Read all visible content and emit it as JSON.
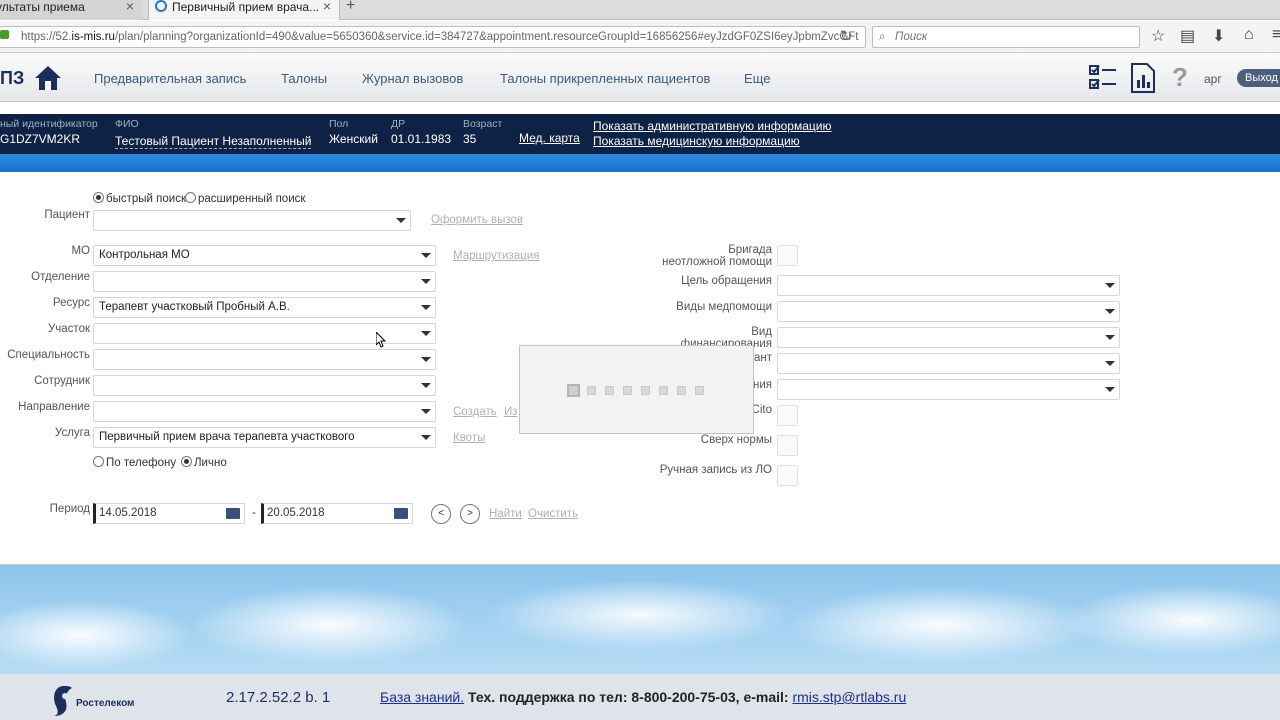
{
  "browser": {
    "tabs": [
      {
        "label": "ультаты приема"
      },
      {
        "label": "Первичный прием врача..."
      }
    ],
    "url_prefix": "https://52.",
    "url_domain": "is-mis.ru",
    "url_rest": "/plan/planning?organizationId=490&value=5650360&service.id=384727&appointment.resourceGroupId=16856256#eyJzdGF0ZSI6eyJpbmZvcGFt",
    "search_placeholder": "Поиск"
  },
  "app": {
    "logo": "ПЗ",
    "menu": [
      "Предварительная запись",
      "Талоны",
      "Журнал вызовов",
      "Талоны прикрепленных пациентов",
      "Еще"
    ],
    "username": "арг",
    "logout": "Выход"
  },
  "patient": {
    "id_label": "ный идентификатор",
    "id_value": "G1DZ7VM2KR",
    "fio_label": "ФИО",
    "fio_value": "Тестовый Пациент Незаполненный",
    "sex_label": "Пол",
    "sex_value": "Женский",
    "dob_label": "ДР",
    "dob_value": "01.01.1983",
    "age_label": "Возраст",
    "age_value": "35",
    "med_card": "Мед. карта",
    "admin_info": "Показать административную информацию",
    "med_info": "Показать медицинскую информацию"
  },
  "form": {
    "search_quick": "быстрый поиск",
    "search_ext": "расширенный поиск",
    "fields": {
      "patient": {
        "label": "Пациент",
        "value": ""
      },
      "mo": {
        "label": "МО",
        "value": "Контрольная МО"
      },
      "department": {
        "label": "Отделение",
        "value": ""
      },
      "resource": {
        "label": "Ресурс",
        "value": "Терапевт участковый Пробный А.В."
      },
      "district": {
        "label": "Участок",
        "value": ""
      },
      "specialty": {
        "label": "Специальность",
        "value": ""
      },
      "employee": {
        "label": "Сотрудник",
        "value": ""
      },
      "referral": {
        "label": "Направление",
        "value": ""
      },
      "service": {
        "label": "Услуга",
        "value": "Первичный прием врача терапевта участкового"
      }
    },
    "links": {
      "call": "Оформить вызов",
      "routing": "Маршрутизация",
      "create": "Создать",
      "edit": "Из",
      "quotas": "Квоты"
    },
    "mode_phone": "По телефону",
    "mode_person": "Лично",
    "period_label": "Период",
    "date_from": "14.05.2018",
    "date_to": "20.05.2018",
    "date_sep": "-",
    "prev": "<",
    "next": ">",
    "find": "Найти",
    "clear": "Очистить",
    "right": {
      "brigade": "Бригада неотложной помощи",
      "purpose": "Цель обращения",
      "care_types": "Виды медпомощи",
      "financing": "Вид финансирования",
      "row5": "ант",
      "row6": "ния",
      "cito": "Cito",
      "over_norm": "Сверх нормы",
      "manual_lo": "Ручная запись из ЛО"
    }
  },
  "footer": {
    "company": "Ростелеком",
    "version": "2.17.2.52.2 b. 1",
    "kb": "База знаний.",
    "support": " Тех. поддержка по тел: 8-800-200-75-03, e-mail: ",
    "email": "rmis.stp@rtlabs.ru"
  }
}
